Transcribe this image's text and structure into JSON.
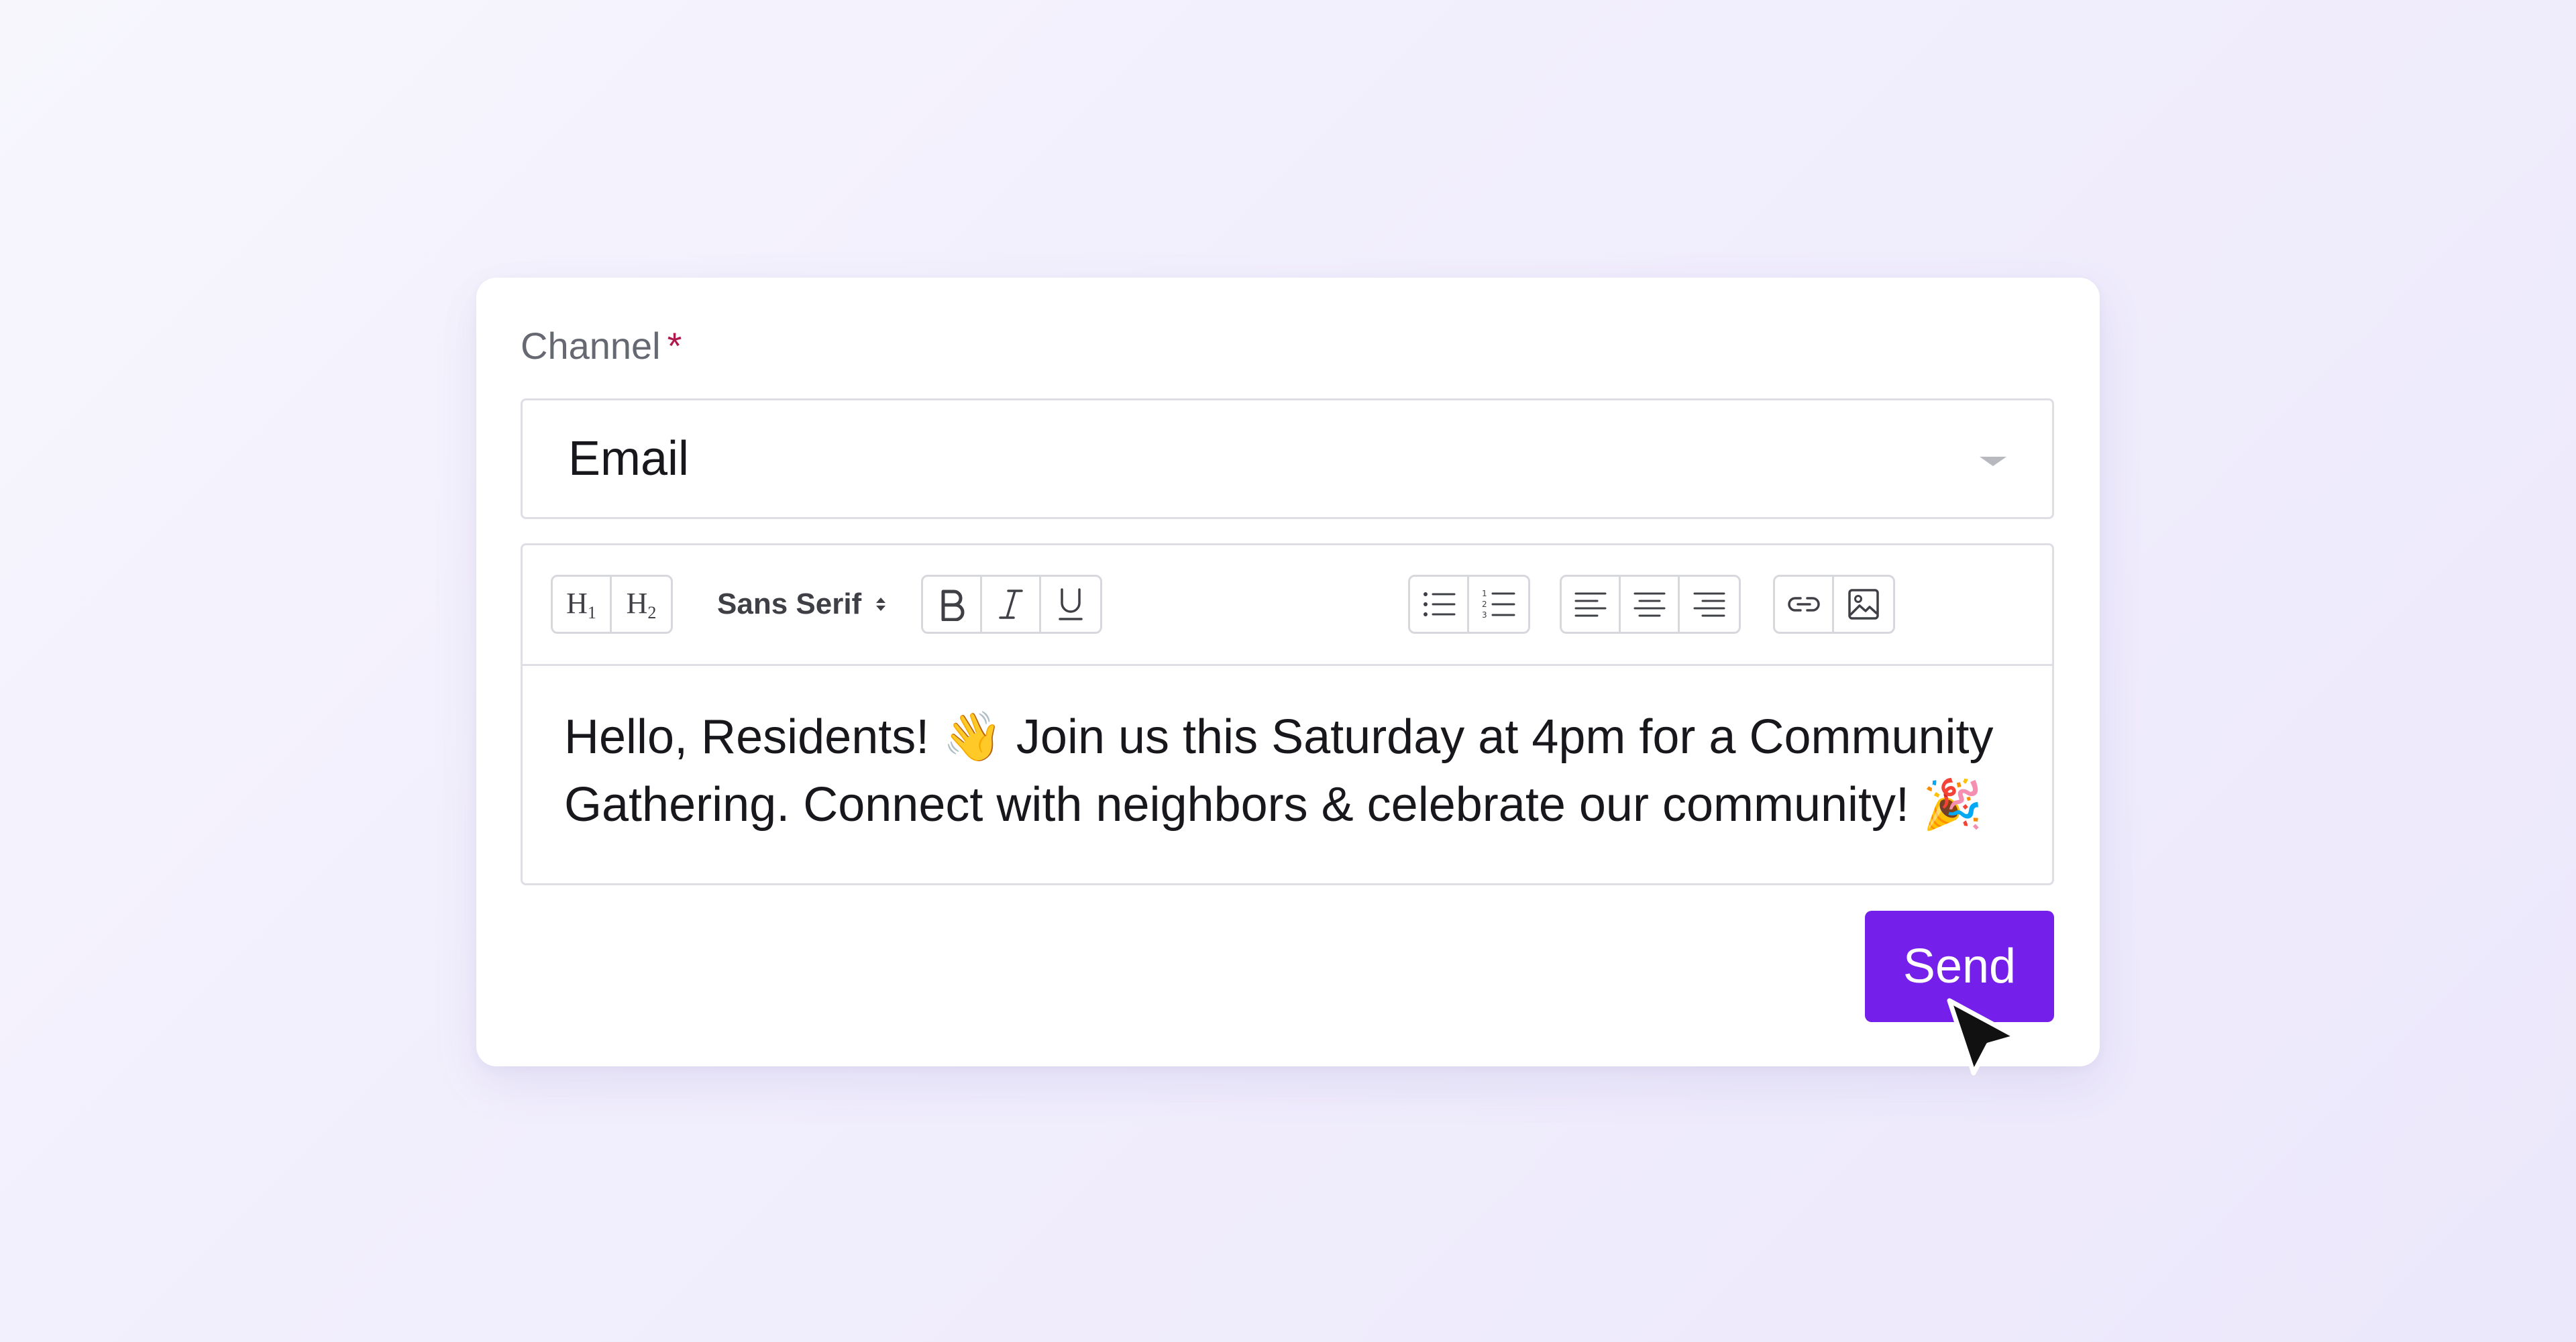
{
  "form": {
    "channel_label": "Channel",
    "required_marker": "*",
    "channel_value": "Email"
  },
  "toolbar": {
    "heading1_label": "H",
    "heading1_sub": "1",
    "heading2_label": "H",
    "heading2_sub": "2",
    "font_family": "Sans Serif",
    "icons": [
      "bold-icon",
      "italic-icon",
      "underline-icon",
      "bullet-list-icon",
      "numbered-list-icon",
      "align-left-icon",
      "align-center-icon",
      "align-right-icon",
      "link-icon",
      "image-icon"
    ]
  },
  "message": {
    "line1": "Hello, Residents! 👋 Join us this Saturday at 4pm for a Community",
    "line2": "Gathering. Connect with neighbors & celebrate our community! 🎉"
  },
  "actions": {
    "send_label": "Send"
  },
  "colors": {
    "accent": "#7420ea",
    "required": "#b0174a"
  }
}
